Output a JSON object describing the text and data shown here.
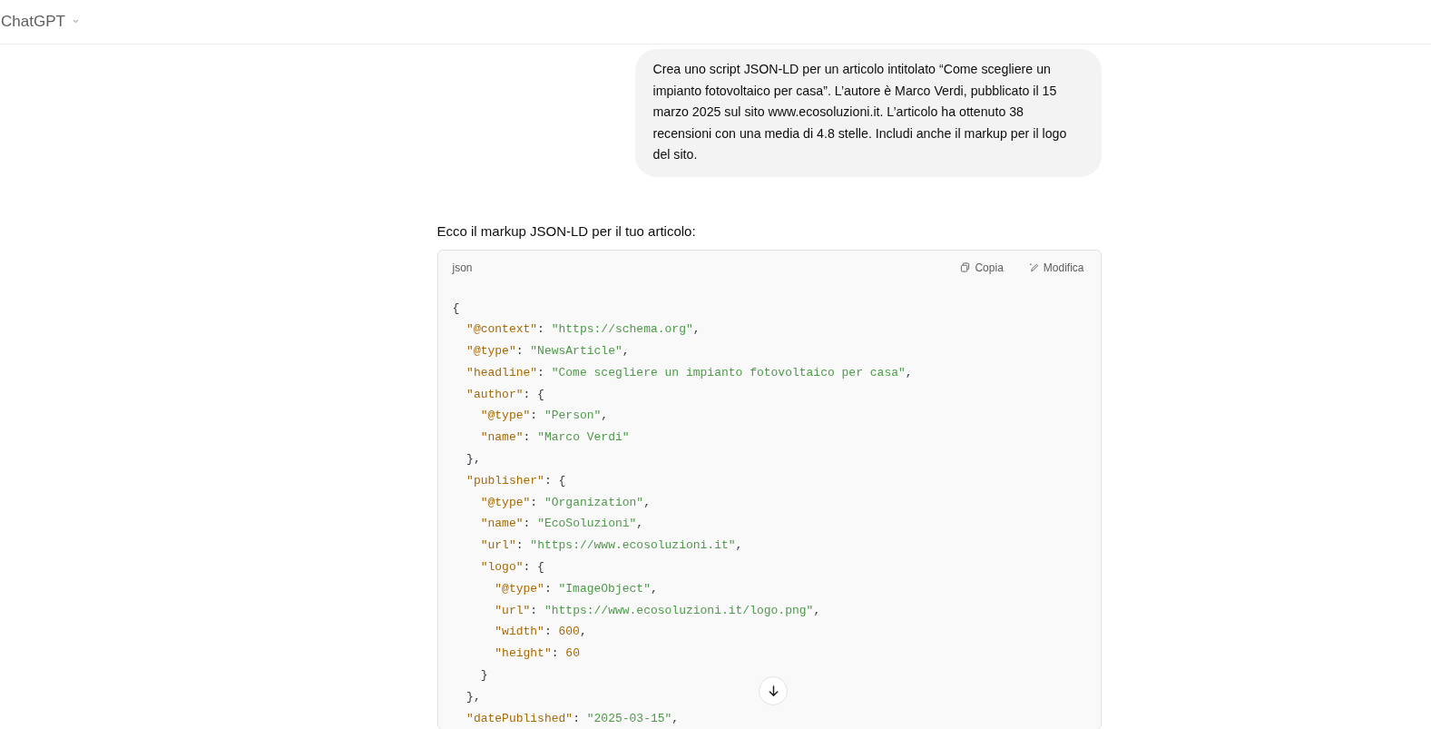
{
  "header": {
    "title": "ChatGPT",
    "caret": "⌄"
  },
  "user_message": "Crea uno script JSON-LD per un articolo intitolato “Come scegliere un impianto fotovoltaico per casa”. L’autore è Marco Verdi, pubblicato il 15 marzo 2025 sul sito www.ecosoluzioni.it. L’articolo ha ottenuto 38 recensioni con una media di 4.8 stelle. Includi anche il markup per il logo del sito.",
  "assistant_intro": "Ecco il markup JSON-LD per il tuo articolo:",
  "code_block": {
    "language": "json",
    "actions": [
      {
        "kind": "copy",
        "label": "Copia"
      },
      {
        "kind": "edit",
        "label": "Modifica"
      }
    ],
    "lines": [
      {
        "tokens": [
          {
            "kind": "punct",
            "text": "{"
          }
        ],
        "children": [
          {
            "tokens": [
              {
                "kind": "key",
                "text": "\"@context\""
              },
              {
                "kind": "punct",
                "text": ": "
              },
              {
                "kind": "string",
                "text": "\"https://schema.org\""
              },
              {
                "kind": "punct",
                "text": ","
              }
            ]
          },
          {
            "tokens": [
              {
                "kind": "key",
                "text": "\"@type\""
              },
              {
                "kind": "punct",
                "text": ": "
              },
              {
                "kind": "string",
                "text": "\"NewsArticle\""
              },
              {
                "kind": "punct",
                "text": ","
              }
            ]
          },
          {
            "tokens": [
              {
                "kind": "key",
                "text": "\"headline\""
              },
              {
                "kind": "punct",
                "text": ": "
              },
              {
                "kind": "string",
                "text": "\"Come scegliere un impianto fotovoltaico per casa\""
              },
              {
                "kind": "punct",
                "text": ","
              }
            ]
          },
          {
            "tokens": [
              {
                "kind": "key",
                "text": "\"author\""
              },
              {
                "kind": "punct",
                "text": ": {"
              }
            ],
            "children": [
              {
                "tokens": [
                  {
                    "kind": "key",
                    "text": "\"@type\""
                  },
                  {
                    "kind": "punct",
                    "text": ": "
                  },
                  {
                    "kind": "string",
                    "text": "\"Person\""
                  },
                  {
                    "kind": "punct",
                    "text": ","
                  }
                ]
              },
              {
                "tokens": [
                  {
                    "kind": "key",
                    "text": "\"name\""
                  },
                  {
                    "kind": "punct",
                    "text": ": "
                  },
                  {
                    "kind": "string",
                    "text": "\"Marco Verdi\""
                  }
                ]
              }
            ]
          },
          {
            "tokens": [
              {
                "kind": "punct",
                "text": "},"
              }
            ]
          },
          {
            "tokens": [
              {
                "kind": "key",
                "text": "\"publisher\""
              },
              {
                "kind": "punct",
                "text": ": {"
              }
            ],
            "children": [
              {
                "tokens": [
                  {
                    "kind": "key",
                    "text": "\"@type\""
                  },
                  {
                    "kind": "punct",
                    "text": ": "
                  },
                  {
                    "kind": "string",
                    "text": "\"Organization\""
                  },
                  {
                    "kind": "punct",
                    "text": ","
                  }
                ]
              },
              {
                "tokens": [
                  {
                    "kind": "key",
                    "text": "\"name\""
                  },
                  {
                    "kind": "punct",
                    "text": ": "
                  },
                  {
                    "kind": "string",
                    "text": "\"EcoSoluzioni\""
                  },
                  {
                    "kind": "punct",
                    "text": ","
                  }
                ]
              },
              {
                "tokens": [
                  {
                    "kind": "key",
                    "text": "\"url\""
                  },
                  {
                    "kind": "punct",
                    "text": ": "
                  },
                  {
                    "kind": "string",
                    "text": "\"https://www.ecosoluzioni.it\""
                  },
                  {
                    "kind": "punct",
                    "text": ","
                  }
                ]
              },
              {
                "tokens": [
                  {
                    "kind": "key",
                    "text": "\"logo\""
                  },
                  {
                    "kind": "punct",
                    "text": ": {"
                  }
                ],
                "children": [
                  {
                    "tokens": [
                      {
                        "kind": "key",
                        "text": "\"@type\""
                      },
                      {
                        "kind": "punct",
                        "text": ": "
                      },
                      {
                        "kind": "string",
                        "text": "\"ImageObject\""
                      },
                      {
                        "kind": "punct",
                        "text": ","
                      }
                    ]
                  },
                  {
                    "tokens": [
                      {
                        "kind": "key",
                        "text": "\"url\""
                      },
                      {
                        "kind": "punct",
                        "text": ": "
                      },
                      {
                        "kind": "string",
                        "text": "\"https://www.ecosoluzioni.it/logo.png\""
                      },
                      {
                        "kind": "punct",
                        "text": ","
                      }
                    ]
                  },
                  {
                    "tokens": [
                      {
                        "kind": "key",
                        "text": "\"width\""
                      },
                      {
                        "kind": "punct",
                        "text": ": "
                      },
                      {
                        "kind": "number",
                        "text": "600"
                      },
                      {
                        "kind": "punct",
                        "text": ","
                      }
                    ]
                  },
                  {
                    "tokens": [
                      {
                        "kind": "key",
                        "text": "\"height\""
                      },
                      {
                        "kind": "punct",
                        "text": ": "
                      },
                      {
                        "kind": "number",
                        "text": "60"
                      }
                    ]
                  }
                ]
              },
              {
                "tokens": [
                  {
                    "kind": "punct",
                    "text": "}"
                  }
                ]
              }
            ]
          },
          {
            "tokens": [
              {
                "kind": "punct",
                "text": "},"
              }
            ]
          },
          {
            "tokens": [
              {
                "kind": "key",
                "text": "\"datePublished\""
              },
              {
                "kind": "punct",
                "text": ": "
              },
              {
                "kind": "string",
                "text": "\"2025-03-15\""
              },
              {
                "kind": "punct",
                "text": ","
              }
            ]
          }
        ]
      }
    ]
  }
}
